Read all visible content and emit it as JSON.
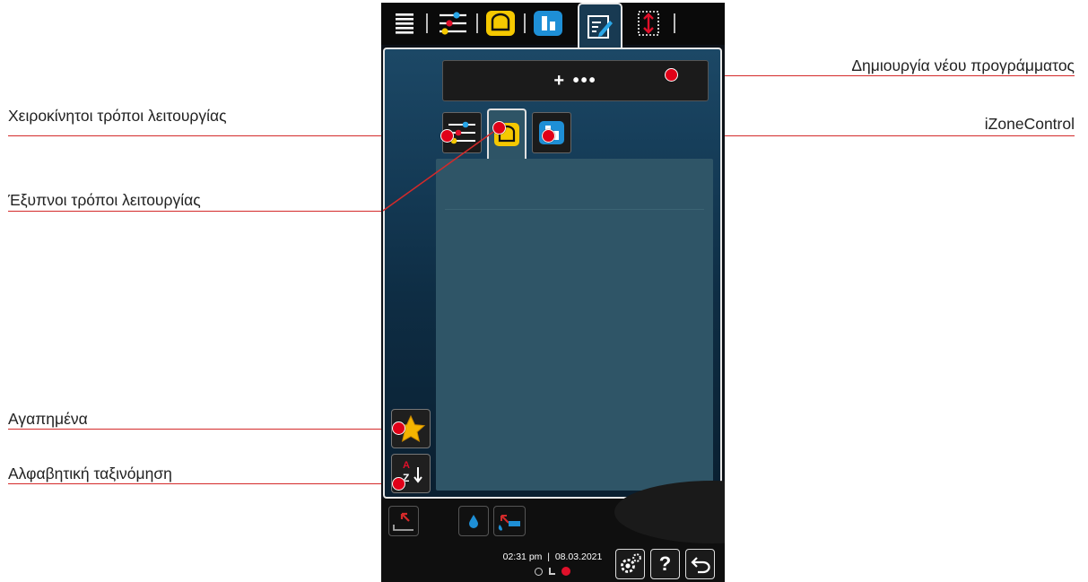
{
  "callouts": {
    "create_new_program": "Δημιουργία νέου προγράμματος",
    "manual_modes": "Χειροκίνητοι τρόποι λειτουργίας",
    "izonecontrol": "iZoneControl",
    "smart_modes": "Έξυπνοι τρόποι λειτουργίας",
    "favourites": "Αγαπημένα",
    "alphabetical_sort": "Αλφαβητική ταξινόμηση"
  },
  "device": {
    "new_program_label": "+ •••",
    "sort_letter_a": "A",
    "sort_letter_z": "Z",
    "time": "02:31 pm",
    "date": "08.03.2021",
    "help_label": "?"
  },
  "icons": {
    "menu": "menu-icon",
    "manual": "sliders-icon",
    "smart": "toast-icon",
    "izone": "izone-icon",
    "edit": "edit-program-icon",
    "expand": "expand-icon",
    "favourite": "star-icon",
    "sort": "sort-az-icon",
    "settings": "gear-icon",
    "help": "help-icon",
    "back": "back-arrow-icon"
  },
  "colors": {
    "callout_red": "#e00018",
    "smart_yellow": "#f5c800",
    "izone_blue": "#1e8fd6",
    "star_gold": "#f4b400"
  }
}
